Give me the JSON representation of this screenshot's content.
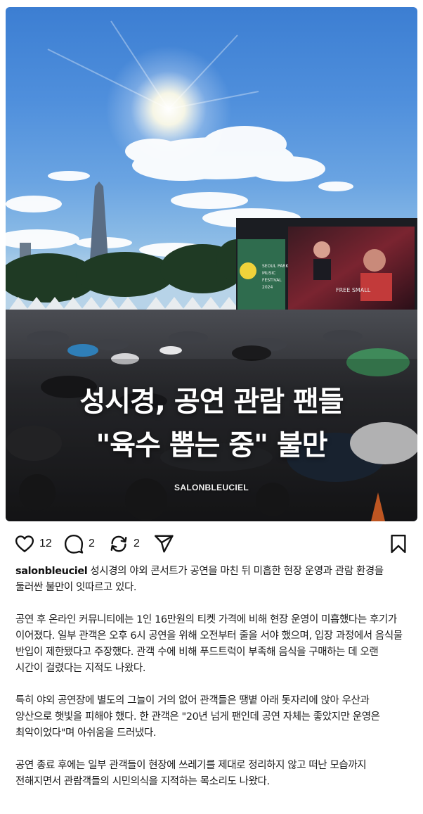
{
  "post": {
    "headline_line1": "성시경, 공연 관람 팬들",
    "headline_line2": "\"육수 뽑는 중\" 불만",
    "watermark": "SALONBLEUCIEL",
    "festival_sign": "SEOUL PARK MUSIC FESTIVAL 2024",
    "stage_screen_text": "FREE SMALL"
  },
  "actions": {
    "like_count": "12",
    "comment_count": "2",
    "repost_count": "2",
    "icons": [
      "heart-icon",
      "comment-bubble-icon",
      "repost-icon",
      "send-icon",
      "bookmark-icon"
    ]
  },
  "caption": {
    "username": "salonbleuciel",
    "paragraph1": "성시경의 야외 콘서트가 공연을 마친 뒤 미흡한 현장 운영과 관람 환경을 둘러싼 불만이 잇따르고 있다.",
    "paragraph2": "공연 후 온라인 커뮤니티에는 1인 16만원의 티켓 가격에 비해 현장 운영이 미흡했다는 후기가 이어졌다. 일부 관객은 오후 6시 공연을 위해 오전부터 줄을 서야 했으며, 입장 과정에서 음식물 반입이 제한됐다고 주장했다. 관객 수에 비해 푸드트럭이 부족해 음식을 구매하는 데 오랜 시간이 걸렸다는 지적도 나왔다.",
    "paragraph3": "특히 야외 공연장에 별도의 그늘이 거의 없어 관객들은 땡볕 아래 돗자리에 앉아 우산과 양산으로 햇빛을 피해야 했다. 한 관객은 \"20년 넘게 팬인데 공연 자체는 좋았지만 운영은 최악이었다\"며 아쉬움을 드러냈다.",
    "paragraph4": "공연 종료 후에는 일부 관객들이 현장에 쓰레기를 제대로 정리하지 않고 떠난 모습까지 전해지면서 관람객들의 시민의식을 지적하는 목소리도 나왔다."
  },
  "colors": {
    "text": "#111111",
    "sky": "#4f8fdc",
    "headline": "#ffffff"
  }
}
